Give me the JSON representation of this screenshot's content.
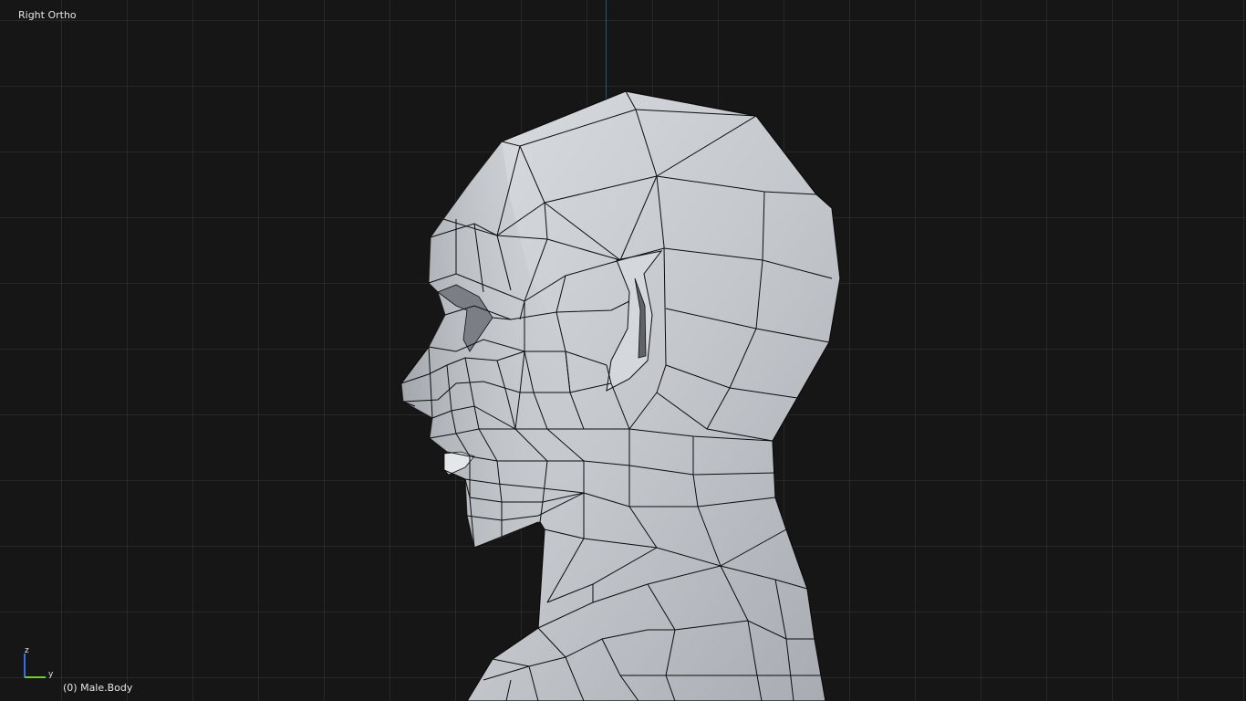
{
  "viewport": {
    "view_label": "Right Ortho",
    "object_label": "(0) Male.Body"
  },
  "gizmo": {
    "z_label": "z",
    "y_label": "y",
    "z_color": "#2f6df2",
    "y_color": "#6bd02a"
  },
  "colors": {
    "background": "#161616",
    "grid": "#2a2a2a",
    "z_axis_line": "#1d5d7a",
    "mesh_fill": "#c5c8cd",
    "mesh_shadow": "#8c9096",
    "wireframe": "#0c0c0c"
  },
  "icons": [
    "axis-gizmo-icon"
  ]
}
